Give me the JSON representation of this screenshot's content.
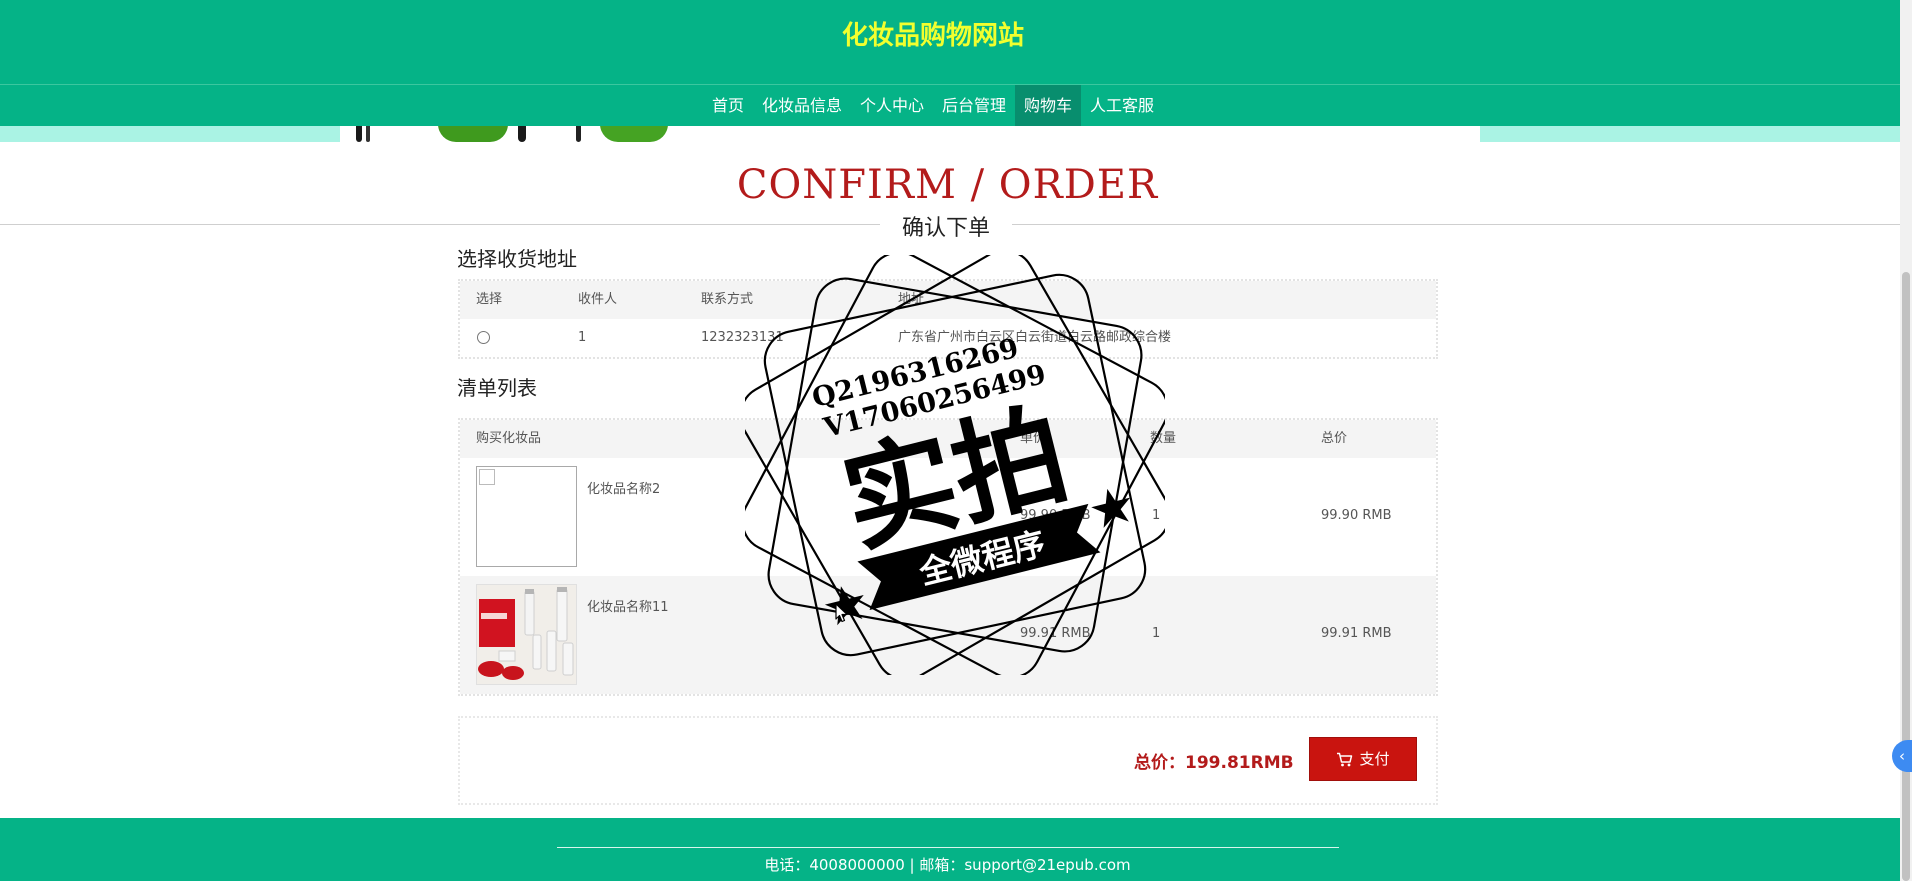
{
  "header": {
    "site_title": "化妆品购物网站"
  },
  "nav": {
    "items": [
      {
        "label": "首页"
      },
      {
        "label": "化妆品信息"
      },
      {
        "label": "个人中心"
      },
      {
        "label": "后台管理"
      },
      {
        "label": "购物车",
        "active": true
      },
      {
        "label": "人工客服"
      }
    ]
  },
  "page_heading": {
    "title_en": "CONFIRM / ORDER",
    "title_cn": "确认下单"
  },
  "address_section": {
    "title": "选择收货地址",
    "columns": [
      "选择",
      "收件人",
      "联系方式",
      "地址"
    ],
    "rows": [
      {
        "recipient": "1",
        "phone": "1232323131",
        "address": "广东省广州市白云区白云街道白云路邮政综合楼"
      }
    ]
  },
  "order_section": {
    "title": "清单列表",
    "columns": [
      "购买化妆品",
      "单价",
      "数量",
      "总价"
    ],
    "items": [
      {
        "name": "化妆品名称2",
        "unit_price": "99.90 RMB",
        "quantity": "1",
        "total": "99.90 RMB"
      },
      {
        "name": "化妆品名称11",
        "unit_price": "99.91 RMB",
        "quantity": "1",
        "total": "99.91 RMB"
      }
    ]
  },
  "summary": {
    "total_label": "总价：199.81RMB",
    "pay_label": "支付"
  },
  "footer": {
    "contact": "电话：4008000000 | 邮箱：support@21epub.com"
  },
  "side_tab": {
    "glyph": "‹"
  },
  "watermark": {
    "line1": "Q2196316269",
    "line2": "V17060256499",
    "big_text": "实拍",
    "ribbon_text": "全微程序"
  },
  "colors": {
    "primary_green": "#05b387",
    "nav_active": "#088e6e",
    "title_yellow": "#f2ff2e",
    "accent_red": "#b31b1b",
    "button_red": "#c9140f"
  },
  "icons": {
    "pay": "cart-icon",
    "side_tab": "chevron-left-icon"
  }
}
